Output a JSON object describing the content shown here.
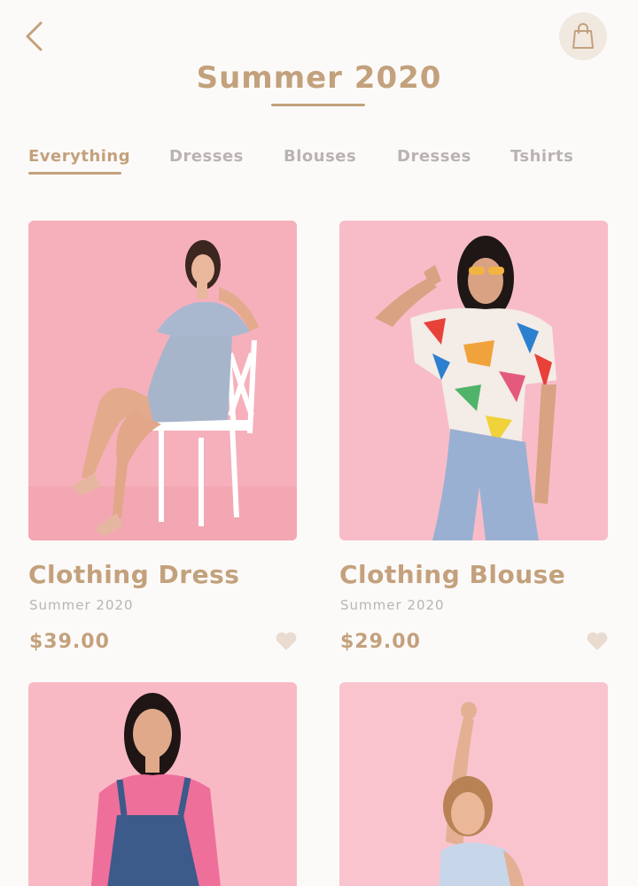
{
  "header": {
    "title": "Summer 2020",
    "back_icon": "chevron-left-icon",
    "bag_icon": "shopping-bag-icon"
  },
  "tabs": [
    {
      "label": "Everything",
      "active": true
    },
    {
      "label": "Dresses",
      "active": false
    },
    {
      "label": "Blouses",
      "active": false
    },
    {
      "label": "Dresses",
      "active": false
    },
    {
      "label": "Tshirts",
      "active": false
    }
  ],
  "products": [
    {
      "name": "Clothing Dress",
      "collection": "Summer 2020",
      "price": "$39.00",
      "image": "woman-in-blue-dress-on-chair"
    },
    {
      "name": "Clothing Blouse",
      "collection": "Summer 2020",
      "price": "$29.00",
      "image": "woman-in-colorful-blouse"
    },
    {
      "image": "woman-in-denim-overalls"
    },
    {
      "image": "woman-in-checked-top"
    }
  ],
  "colors": {
    "accent": "#c3a17c",
    "muted": "#b9b4b1",
    "background": "#fcfaf9",
    "card_pink": "#f6b4bf",
    "heart": "#eadbd0"
  }
}
